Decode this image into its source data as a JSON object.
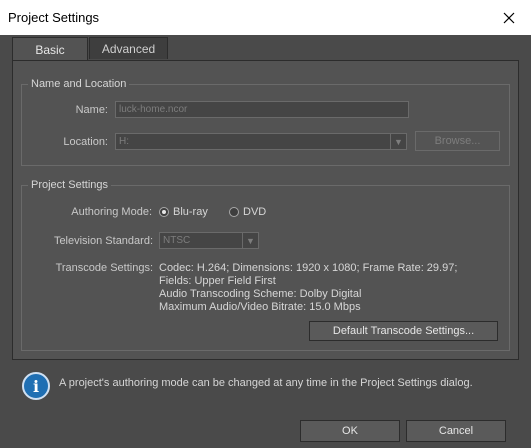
{
  "window": {
    "title": "Project Settings",
    "close_glyph": "✕"
  },
  "tabs": [
    {
      "label": "Basic",
      "active": true
    },
    {
      "label": "Advanced",
      "active": false
    }
  ],
  "name_location": {
    "title": "Name and Location",
    "name_label": "Name:",
    "name_value": "luck-home.ncor",
    "location_label": "Location:",
    "location_value": "H:",
    "browse_label": "Browse..."
  },
  "project_settings": {
    "title": "Project Settings",
    "authoring_mode_label": "Authoring Mode:",
    "authoring_options": [
      {
        "label": "Blu-ray",
        "selected": true
      },
      {
        "label": "DVD",
        "selected": false
      }
    ],
    "tv_standard_label": "Television Standard:",
    "tv_standard_value": "NTSC",
    "transcode_label": "Transcode Settings:",
    "transcode_lines": [
      "Codec: H.264; Dimensions: 1920 x 1080; Frame Rate: 29.97;",
      "Fields: Upper Field First",
      "Audio Transcoding Scheme: Dolby Digital",
      "Maximum Audio/Video Bitrate: 15.0 Mbps"
    ],
    "default_transcode_button": "Default Transcode Settings..."
  },
  "info": {
    "icon": "info-icon",
    "message": "A project's authoring mode can be changed at any time in the Project Settings dialog."
  },
  "footer": {
    "ok_label": "OK",
    "cancel_label": "Cancel"
  }
}
